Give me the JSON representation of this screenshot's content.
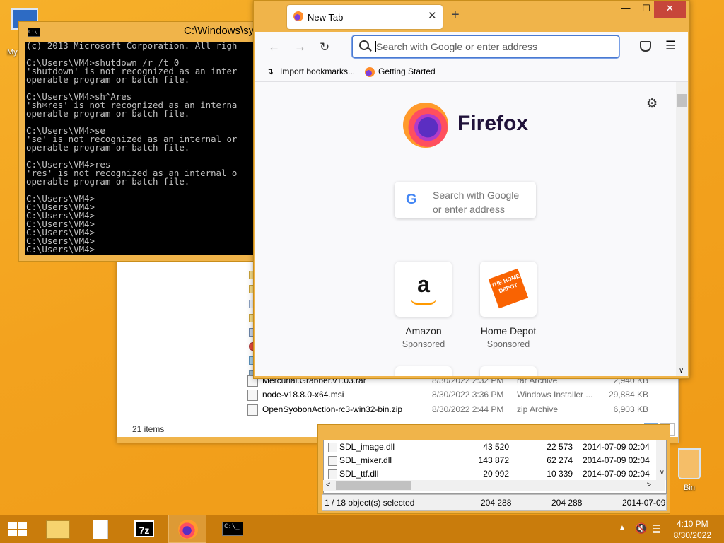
{
  "desktop": {
    "recycle_bin_label": "Bin",
    "my_computer_label": "My"
  },
  "explorer": {
    "rows": [
      {
        "name": "Mercurial.Grabber.v1.03.rar",
        "date": "8/30/2022 2:32 PM",
        "type": "rar Archive",
        "size": "2,940 KB"
      },
      {
        "name": "node-v18.8.0-x64.msi",
        "date": "8/30/2022 3:36 PM",
        "type": "Windows Installer ...",
        "size": "29,884 KB"
      },
      {
        "name": "OpenSyobonAction-rc3-win32-bin.zip",
        "date": "8/30/2022 2:44 PM",
        "type": "zip Archive",
        "size": "6,903 KB"
      }
    ],
    "items_count": "21 items"
  },
  "sevenzip": {
    "rows": [
      {
        "name": "SDL_image.dll",
        "size": "43 520",
        "packed": "22 573",
        "modified": "2014-07-09 02:04"
      },
      {
        "name": "SDL_mixer.dll",
        "size": "143 872",
        "packed": "62 274",
        "modified": "2014-07-09 02:04"
      },
      {
        "name": "SDL_ttf.dll",
        "size": "20 992",
        "packed": "10 339",
        "modified": "2014-07-09 02:04"
      }
    ],
    "status": {
      "selected": "1 / 18 object(s) selected",
      "size": "204 288",
      "packed": "204 288",
      "modified": "2014-07-09"
    }
  },
  "cmd": {
    "title": "C:\\Windows\\sy",
    "icon_text": "C:\\",
    "output": "(c) 2013 Microsoft Corporation. All righ\n\nC:\\Users\\VM4>shutdown /r /t 0\n'shutdown' is not recognized as an inter\noperable program or batch file.\n\nC:\\Users\\VM4>sh^Ares\n'sh☺res' is not recognized as an interna\noperable program or batch file.\n\nC:\\Users\\VM4>se\n'se' is not recognized as an internal or\noperable program or batch file.\n\nC:\\Users\\VM4>res\n'res' is not recognized as an internal o\noperable program or batch file.\n\nC:\\Users\\VM4>\nC:\\Users\\VM4>\nC:\\Users\\VM4>\nC:\\Users\\VM4>\nC:\\Users\\VM4>\nC:\\Users\\VM4>\nC:\\Users\\VM4>"
  },
  "firefox": {
    "tab_label": "New Tab",
    "new_tab_symbol": "+",
    "window_controls": {
      "minimize": "—",
      "maximize": "☐",
      "close": "✕"
    },
    "url_placeholder": "Search with Google or enter address",
    "bookmarks": [
      {
        "label": "Import bookmarks...",
        "icon": "import-icon"
      },
      {
        "label": "Getting Started",
        "icon": "firefox-icon"
      }
    ],
    "brand_name": "Firefox",
    "search_placeholder_line1": "Search with Google",
    "search_placeholder_line2": "or enter address",
    "search_logo": "G",
    "tiles": [
      {
        "name": "Amazon",
        "sub": "Sponsored",
        "logo": "a"
      },
      {
        "name": "Home Depot",
        "sub": "Sponsored",
        "logo": "THE HOME DEPOT"
      }
    ]
  },
  "taskbar": {
    "time": "4:10 PM",
    "date": "8/30/2022",
    "sevenzip_icon_text": "7z",
    "cmd_icon_text": "C:\\_"
  },
  "colors": {
    "desktop": "#f3a21e",
    "window_frame": "#f0b44a",
    "taskbar": "#c97c0c",
    "accent_blue": "#4a7ad1"
  }
}
